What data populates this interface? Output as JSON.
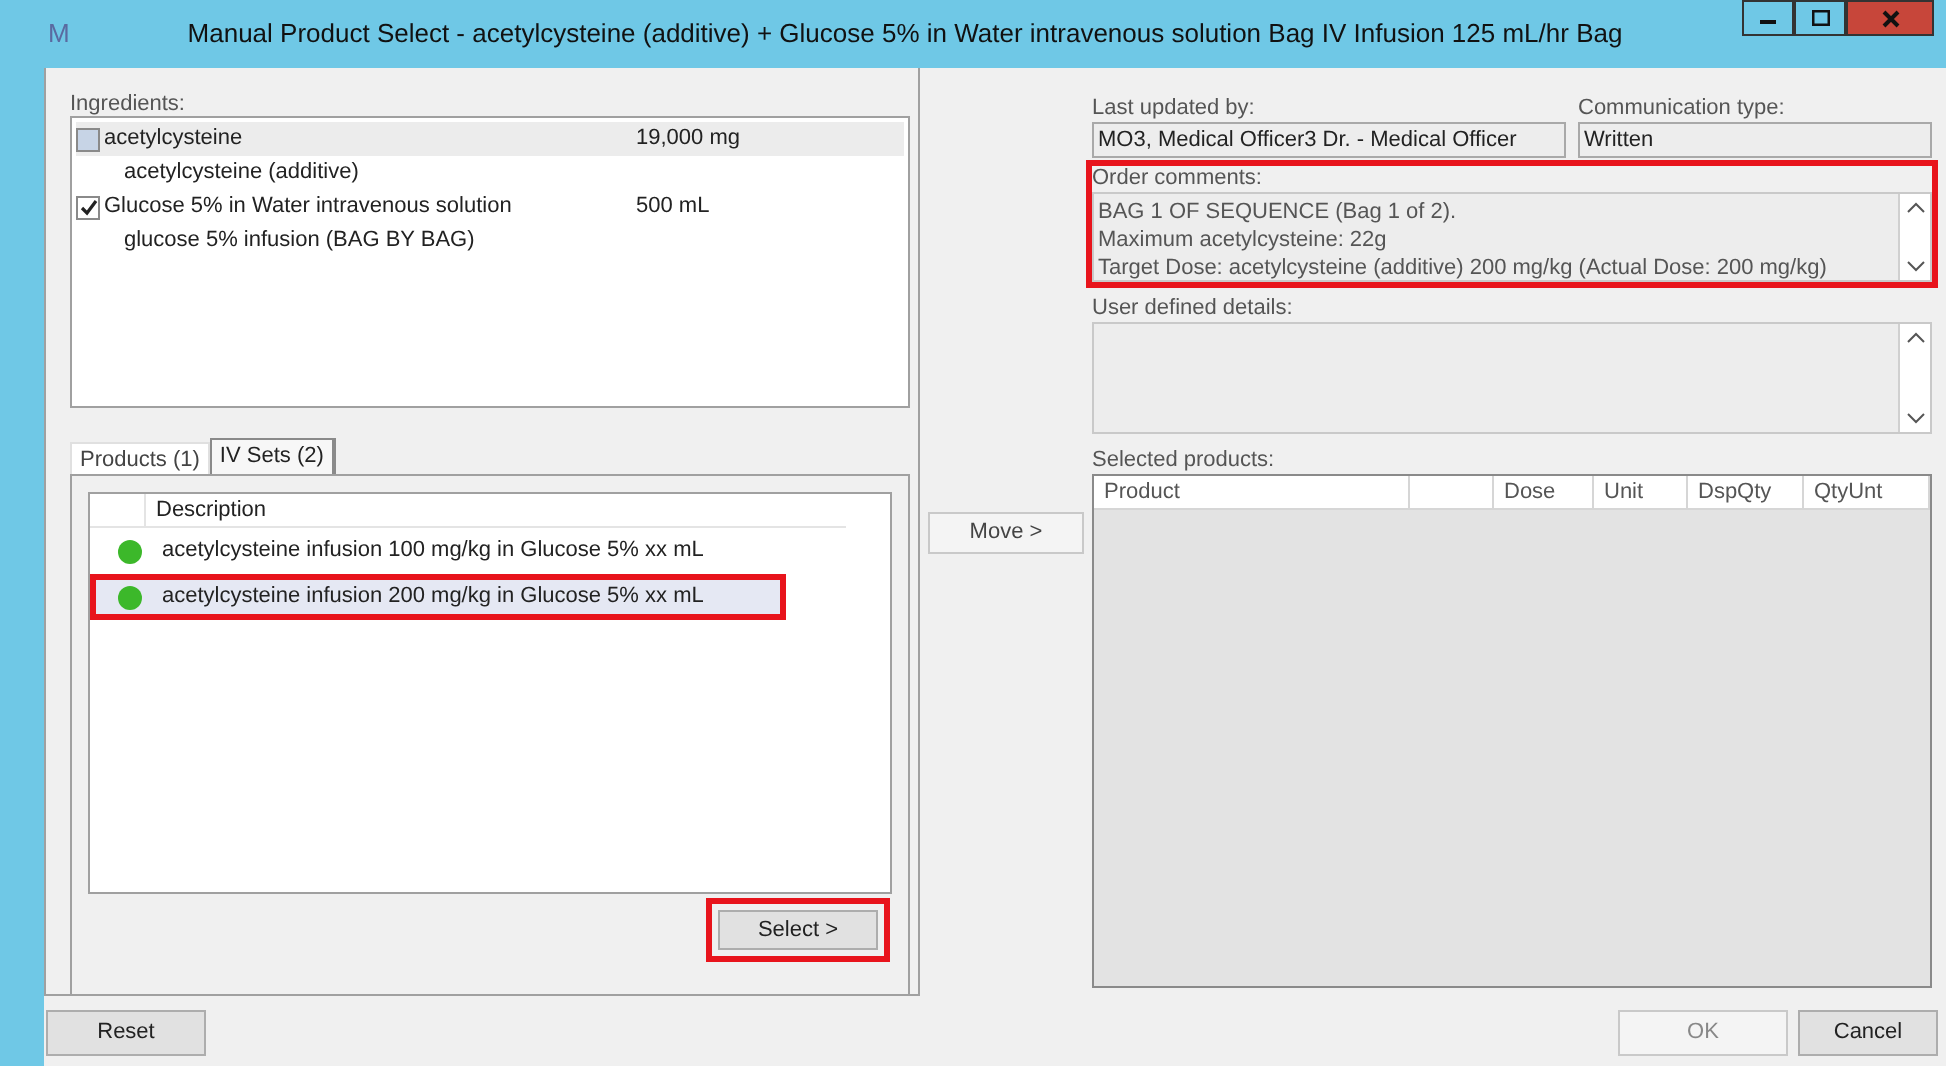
{
  "window": {
    "icon_letter": "M",
    "title": "Manual Product Select - acetylcysteine (additive) + Glucose 5% in Water intravenous solution Bag IV Infusion  125 mL/hr Bag"
  },
  "ingredients": {
    "label": "Ingredients:",
    "items": [
      {
        "name": "acetylcysteine",
        "amount": "19,000 mg",
        "checked": false,
        "selected": true,
        "detail": "acetylcysteine (additive)"
      },
      {
        "name": "Glucose 5% in Water intravenous solution",
        "amount": "500 mL",
        "checked": true,
        "selected": false,
        "detail": "glucose 5% infusion (BAG BY BAG)"
      }
    ]
  },
  "tabs": [
    {
      "label": "Products (1)",
      "selected": false
    },
    {
      "label": "IV Sets (2)",
      "selected": true
    }
  ],
  "products": {
    "columns": [
      "Description"
    ],
    "rows": [
      {
        "description": "acetylcysteine infusion 100 mg/kg in Glucose 5% xx mL",
        "color": "#3cb82a",
        "selected": false,
        "highlighted": false
      },
      {
        "description": "acetylcysteine infusion 200 mg/kg in Glucose 5% xx mL",
        "color": "#3cb82a",
        "selected": true,
        "highlighted": true
      }
    ]
  },
  "select_button": {
    "label": "Select >",
    "highlighted": true
  },
  "move_button": "Move >",
  "last_updated": {
    "label": "Last updated by:",
    "value": "MO3, Medical Officer3  Dr. - Medical Officer"
  },
  "communication": {
    "label": "Communication type:",
    "value": "Written"
  },
  "order_comments": {
    "label": "Order comments:",
    "lines": [
      "BAG 1 OF SEQUENCE (Bag 1 of 2).",
      "Maximum acetylcysteine: 22g",
      "Target Dose: acetylcysteine (additive) 200 mg/kg (Actual Dose: 200 mg/kg)"
    ],
    "highlighted": true
  },
  "user_defined": {
    "label": "User defined details:"
  },
  "selected_products": {
    "label": "Selected products:",
    "columns": [
      "Product",
      "",
      "Dose",
      "Unit",
      "DspQty",
      "QtyUnt"
    ]
  },
  "buttons": [
    {
      "label": "Reset",
      "disabled": false
    },
    {
      "label": "OK",
      "disabled": true
    },
    {
      "label": "Cancel",
      "disabled": false
    }
  ]
}
